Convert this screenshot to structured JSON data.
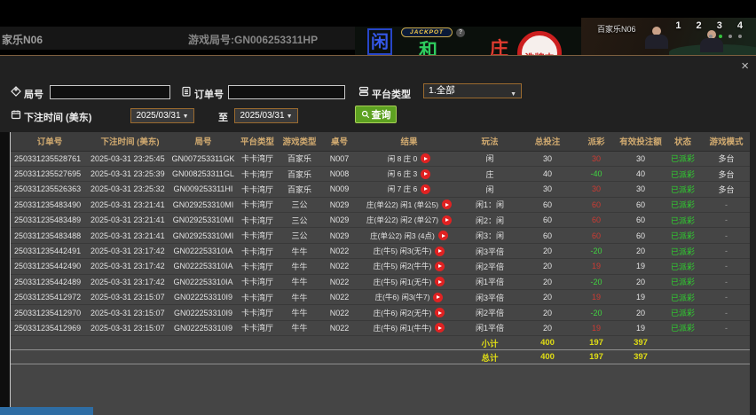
{
  "top_bar": {
    "table_name": "家乐N06",
    "game_round": "游戏局号:GN006253311HP",
    "zones": {
      "player": "闲",
      "tie": "和",
      "banker": "庄",
      "jackpot": "JACKPOT",
      "help": "?"
    },
    "shuffle_text": "洗牌中",
    "video": {
      "title": "百家乐N06",
      "seats": "1 2 3 4"
    }
  },
  "modal": {
    "close_glyph": "×",
    "filters": {
      "round_label": "局号",
      "order_label": "订单号",
      "platform_label": "平台类型",
      "platform_value": "1.全部",
      "bet_time_label": "下注时间 (美东)",
      "date_from": "2025/03/31",
      "date_to": "2025/03/31",
      "to_label": "至",
      "search_label": "查询",
      "caret_glyph": "▼"
    },
    "table": {
      "headers": [
        "订单号",
        "下注时间 (美东)",
        "局号",
        "平台类型",
        "游戏类型",
        "桌号",
        "结果",
        "玩法",
        "总投注",
        "派彩",
        "有效投注额",
        "状态",
        "游戏模式"
      ],
      "rows": [
        {
          "cells": [
            "250331235528761",
            "2025-03-31 23:25:45",
            "GN007253311GK",
            "卡卡湾厅",
            "百家乐",
            "N007",
            "闲 8 庄 0",
            "闲",
            "30",
            "30",
            "30",
            "已派彩",
            "多台"
          ]
        },
        {
          "cells": [
            "250331235527695",
            "2025-03-31 23:25:39",
            "GN008253311GL",
            "卡卡湾厅",
            "百家乐",
            "N008",
            "闲 6 庄 3",
            "庄",
            "40",
            "-40",
            "40",
            "已派彩",
            "多台"
          ]
        },
        {
          "cells": [
            "250331235526363",
            "2025-03-31 23:25:32",
            "GN009253311HI",
            "卡卡湾厅",
            "百家乐",
            "N009",
            "闲 7 庄 6",
            "闲",
            "30",
            "30",
            "30",
            "已派彩",
            "多台"
          ]
        },
        {
          "cells": [
            "250331235483490",
            "2025-03-31 23:21:41",
            "GN029253310MI",
            "卡卡湾厅",
            "三公",
            "N029",
            "庄(单公2) 闲1 (单公5)",
            "闲1：闲",
            "60",
            "60",
            "60",
            "已派彩",
            "-"
          ]
        },
        {
          "cells": [
            "250331235483489",
            "2025-03-31 23:21:41",
            "GN029253310MI",
            "卡卡湾厅",
            "三公",
            "N029",
            "庄(单公2) 闲2 (单公7)",
            "闲2：闲",
            "60",
            "60",
            "60",
            "已派彩",
            "-"
          ]
        },
        {
          "cells": [
            "250331235483488",
            "2025-03-31 23:21:41",
            "GN029253310MI",
            "卡卡湾厅",
            "三公",
            "N029",
            "庄(单公2) 闲3 (4点)",
            "闲3：闲",
            "60",
            "60",
            "60",
            "已派彩",
            "-"
          ]
        },
        {
          "cells": [
            "250331235442491",
            "2025-03-31 23:17:42",
            "GN022253310IA",
            "卡卡湾厅",
            "牛牛",
            "N022",
            "庄(牛5) 闲3(无牛)",
            "闲3平倍",
            "20",
            "-20",
            "20",
            "已派彩",
            "-"
          ]
        },
        {
          "cells": [
            "250331235442490",
            "2025-03-31 23:17:42",
            "GN022253310IA",
            "卡卡湾厅",
            "牛牛",
            "N022",
            "庄(牛5) 闲2(牛牛)",
            "闲2平倍",
            "20",
            "19",
            "19",
            "已派彩",
            "-"
          ]
        },
        {
          "cells": [
            "250331235442489",
            "2025-03-31 23:17:42",
            "GN022253310IA",
            "卡卡湾厅",
            "牛牛",
            "N022",
            "庄(牛5) 闲1(无牛)",
            "闲1平倍",
            "20",
            "-20",
            "20",
            "已派彩",
            "-"
          ]
        },
        {
          "cells": [
            "250331235412972",
            "2025-03-31 23:15:07",
            "GN022253310I9",
            "卡卡湾厅",
            "牛牛",
            "N022",
            "庄(牛6) 闲3(牛7)",
            "闲3平倍",
            "20",
            "19",
            "19",
            "已派彩",
            "-"
          ]
        },
        {
          "cells": [
            "250331235412970",
            "2025-03-31 23:15:07",
            "GN022253310I9",
            "卡卡湾厅",
            "牛牛",
            "N022",
            "庄(牛6) 闲2(无牛)",
            "闲2平倍",
            "20",
            "-20",
            "20",
            "已派彩",
            "-"
          ]
        },
        {
          "cells": [
            "250331235412969",
            "2025-03-31 23:15:07",
            "GN022253310I9",
            "卡卡湾厅",
            "牛牛",
            "N022",
            "庄(牛6) 闲1(牛牛)",
            "闲1平倍",
            "20",
            "19",
            "19",
            "已派彩",
            "-"
          ]
        }
      ],
      "subtotal": {
        "label": "小计",
        "total_bet": "400",
        "payout": "197",
        "valid_bet": "397"
      },
      "total": {
        "label": "总计",
        "total_bet": "400",
        "payout": "197",
        "valid_bet": "397"
      }
    }
  },
  "colors": {
    "payout_positive": "#cc3b33",
    "payout_negative": "#41d541",
    "status_paid": "#2ed52e",
    "summary_yellow": "#e0dd15",
    "header_gold": "#d2ab70",
    "search_green": "#5da121",
    "filter_border_orange": "#9b6b2f",
    "player_blue": "#3558e8",
    "tie_green": "#2ecc5e",
    "banker_red": "#e03b2f",
    "shuffle_red": "#cc1f1f",
    "bottom_bar_blue": "#2e6da4"
  }
}
